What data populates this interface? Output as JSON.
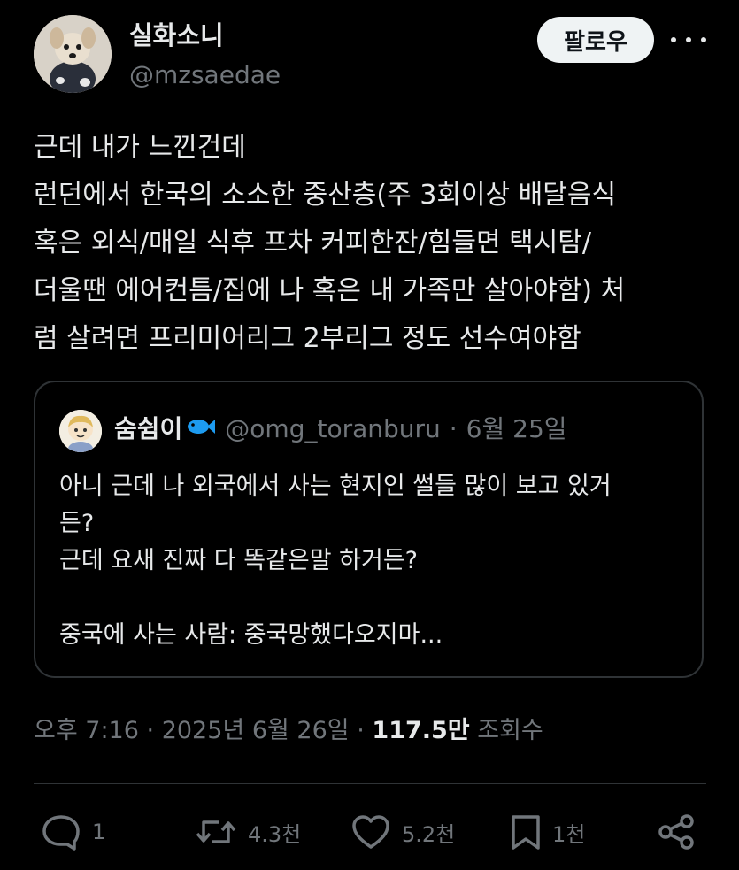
{
  "colors": {
    "background": "#000000",
    "text_primary": "#e7e9ea",
    "text_secondary": "#71767b",
    "border": "#2f3336",
    "follow_bg": "#eff3f4",
    "fish_blue": "#1d9bf0"
  },
  "author": {
    "display_name": "실화소니",
    "handle": "@mzsaedae",
    "follow_label": "팔로우"
  },
  "icons": {
    "more": "more-icon",
    "reply": "reply-icon",
    "retweet": "retweet-icon",
    "like": "heart-icon",
    "bookmark": "bookmark-icon",
    "share": "share-icon",
    "fish": "fish-icon"
  },
  "tweet": {
    "lines": [
      "근데 내가 느낀건데",
      "런던에서 한국의 소소한 중산층(주 3회이상 배달음식",
      "혹은 외식/매일 식후 프차 커피한잔/힘들면 택시탐/",
      "더울땐 에어컨틈/집에 나 혹은 내 가족만 살아야함) 처",
      "럼 살려면 프리미어리그 2부리그 정도 선수여야함"
    ]
  },
  "quote": {
    "display_name": "숨쉼이",
    "handle": "@omg_toranburu",
    "separator": "·",
    "date": "6월 25일",
    "lines": [
      "아니 근데 나 외국에서 사는 현지인 썰들 많이 보고 있거",
      "든?",
      "근데 요새 진짜 다 똑같은말 하거든?",
      "",
      "중국에 사는 사람: 중국망했다오지마..."
    ]
  },
  "meta": {
    "time": "오후 7:16",
    "separator": "·",
    "date": "2025년 6월 26일",
    "views_count": "117.5만",
    "views_label": "조회수"
  },
  "actions": {
    "replies": "1",
    "retweets": "4.3천",
    "likes": "5.2천",
    "bookmarks": "1천"
  }
}
